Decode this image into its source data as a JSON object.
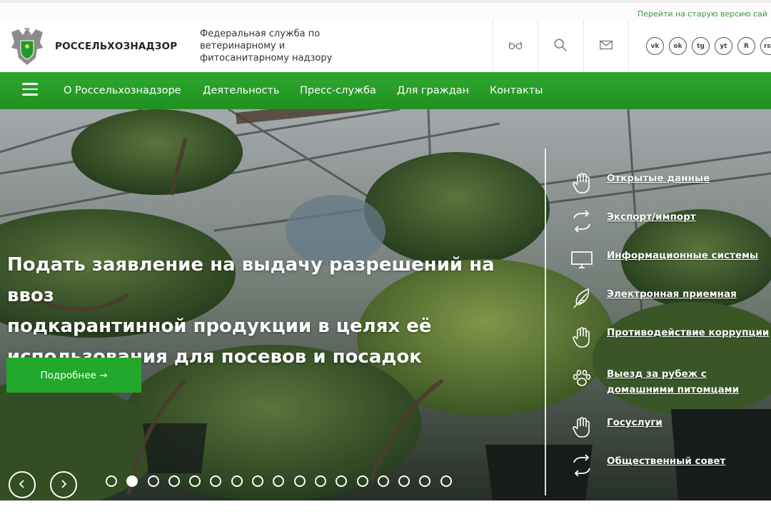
{
  "top_bar": {
    "old_version_link": "Перейти на старую версию сай"
  },
  "header": {
    "org_name": "РОССЕЛЬХОЗНАДЗОР",
    "description_lines": [
      "Федеральная служба по",
      "ветеринарному и",
      "фитосанитарному надзору"
    ],
    "buttons": [
      "glasses-icon",
      "search-icon",
      "mail-icon"
    ],
    "socials": [
      {
        "icon": "vk-icon",
        "glyph": "vk"
      },
      {
        "icon": "odnoklassniki-icon",
        "glyph": "ok"
      },
      {
        "icon": "telegram-icon",
        "glyph": "tg"
      },
      {
        "icon": "youtube-icon",
        "glyph": "yt"
      },
      {
        "icon": "rutube-icon",
        "glyph": "R"
      },
      {
        "icon": "rss-icon",
        "glyph": "rss"
      }
    ]
  },
  "nav": {
    "items": [
      "О Россельхознадзоре",
      "Деятельность",
      "Пресс-служба",
      "Для граждан",
      "Контакты"
    ]
  },
  "hero": {
    "title_lines": [
      "Подать заявление на выдачу разрешений на ввоз",
      "подкарантинной продукции в целях её",
      "использования для посевов и посадок"
    ],
    "more_button": "Подробнее →",
    "slides_total": 17,
    "active_slide": 2,
    "quick_links": [
      {
        "label": "Открытые данные",
        "icon": "hand-icon"
      },
      {
        "label": "Экспорт/импорт",
        "icon": "exchange-arrows-icon"
      },
      {
        "label": "Информационные системы",
        "icon": "monitor-icon"
      },
      {
        "label": "Электронная приемная",
        "icon": "feather-icon"
      },
      {
        "label": "Противодействие коррупции",
        "icon": "hand-icon"
      },
      {
        "label": "Выезд за рубеж с домашними питомцами",
        "icon": "paw-icon"
      },
      {
        "label": "Госуслуги",
        "icon": "hand-icon"
      },
      {
        "label": "Общественный совет",
        "icon": "exchange-arrows-icon"
      }
    ]
  },
  "colors": {
    "brand_green": "#229a26",
    "link_green": "#3a9a3a",
    "white": "#ffffff"
  }
}
